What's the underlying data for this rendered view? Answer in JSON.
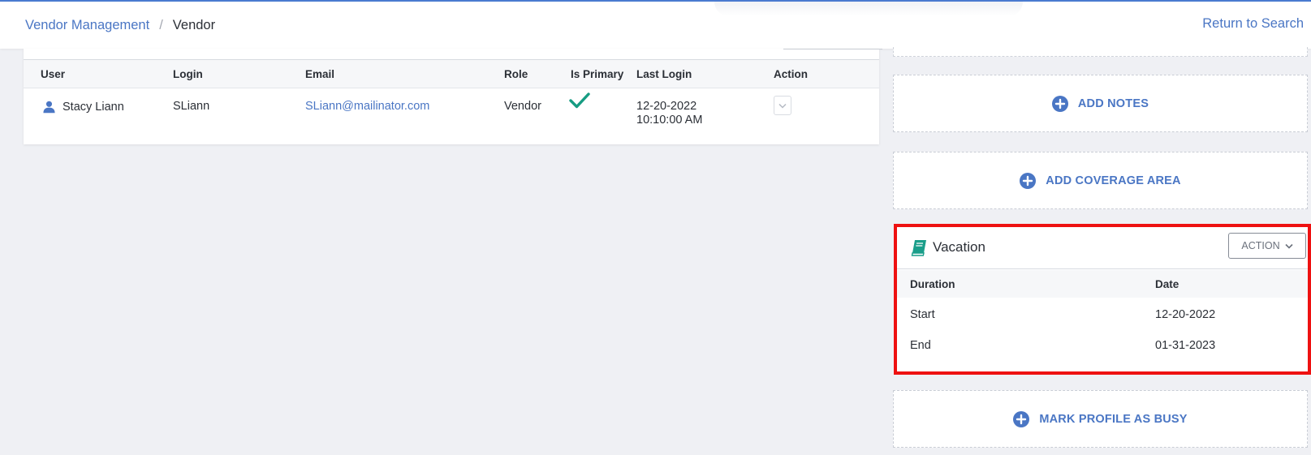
{
  "header": {
    "breadcrumb": {
      "parent": "Vendor Management",
      "separator": "/",
      "current": "Vendor"
    },
    "return_link": "Return to Search"
  },
  "users_table": {
    "columns": [
      "User",
      "Login",
      "Email",
      "Role",
      "Is Primary",
      "Last Login",
      "Action"
    ],
    "rows": [
      {
        "user": "Stacy Liann",
        "login": "SLiann",
        "email": "SLiann@mailinator.com",
        "role": "Vendor",
        "is_primary": true,
        "last_login_date": "12-20-2022",
        "last_login_time": "10:10:00 AM"
      }
    ]
  },
  "right_panel": {
    "add_notes": "ADD NOTES",
    "add_coverage_area": "ADD COVERAGE AREA",
    "mark_busy": "MARK PROFILE AS BUSY",
    "vacation": {
      "title": "Vacation",
      "action_label": "ACTION",
      "columns": [
        "Duration",
        "Date"
      ],
      "rows": [
        {
          "duration": "Start",
          "date": "12-20-2022"
        },
        {
          "duration": "End",
          "date": "01-31-2023"
        }
      ]
    }
  },
  "colors": {
    "accent": "#4a76c4",
    "check": "#169c82",
    "book": "#1a9e8a",
    "highlight": "#ee1111"
  },
  "icons": [
    "person-icon",
    "checkmark-icon",
    "chevron-down-icon",
    "plus-circle-icon",
    "book-icon"
  ]
}
